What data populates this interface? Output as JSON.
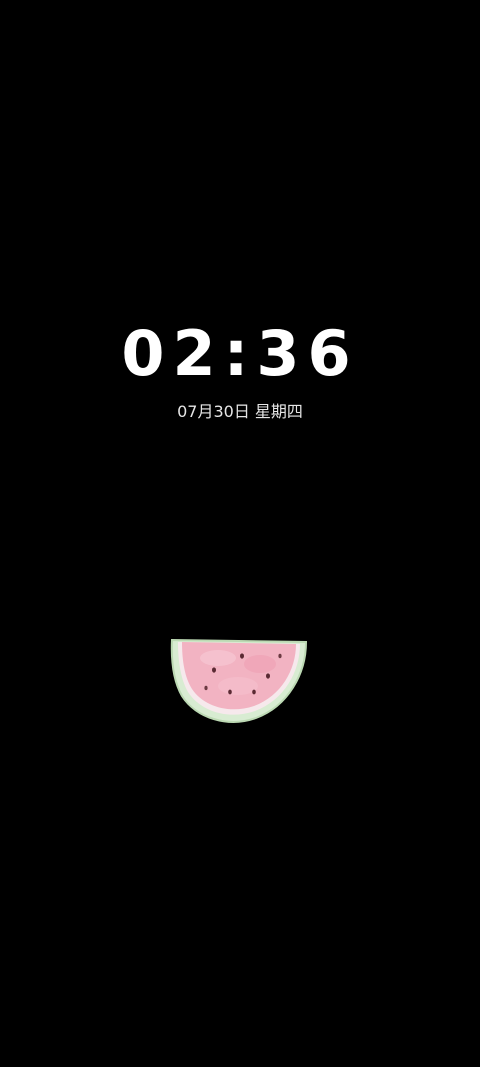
{
  "lock_screen": {
    "time": "02:36",
    "date": "07月30日 星期四",
    "sticker": "watermelon-slice-icon"
  },
  "colors": {
    "background": "#000000",
    "time_text": "#ffffff",
    "date_text": "#e6e6e6",
    "watermelon_flesh": "#f2b3c2",
    "watermelon_rind": "#cfe8c7"
  }
}
